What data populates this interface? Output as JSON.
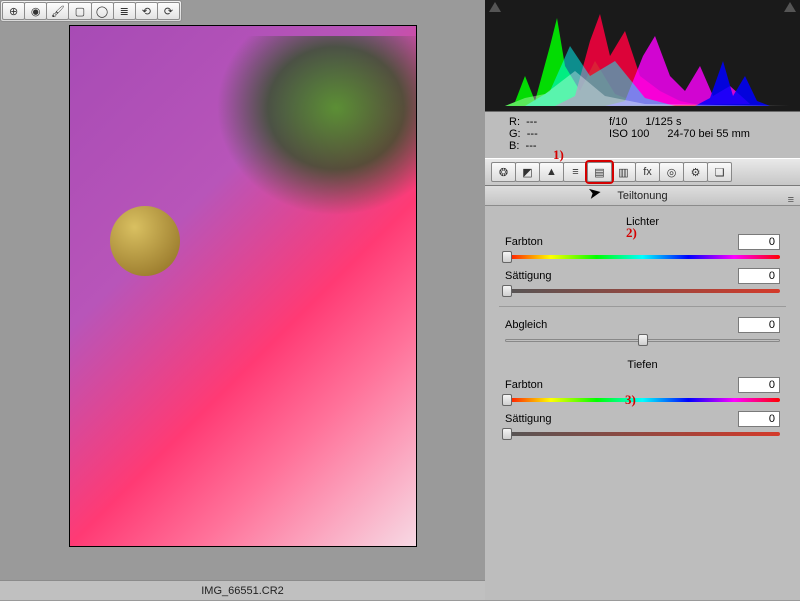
{
  "toolbar_left": {
    "items": [
      {
        "name": "target-tool-icon",
        "glyph": "⊕"
      },
      {
        "name": "eye-tool-icon",
        "glyph": "◉"
      },
      {
        "name": "brush-tool-icon",
        "glyph": "🖌"
      },
      {
        "name": "crop-tool-icon",
        "glyph": "▢"
      },
      {
        "name": "ellipse-tool-icon",
        "glyph": "◯"
      },
      {
        "name": "list-tool-icon",
        "glyph": "≣"
      },
      {
        "name": "rotate-ccw-icon",
        "glyph": "⟲"
      },
      {
        "name": "rotate-cw-icon",
        "glyph": "⟳"
      }
    ]
  },
  "filename": "IMG_66551.CR2",
  "readout": {
    "r_label": "R:",
    "r_val": "---",
    "g_label": "G:",
    "g_val": "---",
    "b_label": "B:",
    "b_val": "---",
    "aperture": "f/10",
    "shutter": "1/125 s",
    "iso": "ISO 100",
    "lens": "24-70 bei 55 mm"
  },
  "panel_toolbar": {
    "items": [
      {
        "name": "aperture-icon",
        "glyph": "❂"
      },
      {
        "name": "tonecurve-icon",
        "glyph": "◩"
      },
      {
        "name": "detail-icon",
        "glyph": "▲"
      },
      {
        "name": "hsl-icon",
        "glyph": "≡"
      },
      {
        "name": "splittone-icon",
        "glyph": "▤",
        "selected": true
      },
      {
        "name": "lens-icon",
        "glyph": "▥"
      },
      {
        "name": "fx-icon",
        "glyph": "fx"
      },
      {
        "name": "camera-icon",
        "glyph": "◎"
      },
      {
        "name": "sliders-icon",
        "glyph": "⚙"
      },
      {
        "name": "presets-icon",
        "glyph": "❏"
      }
    ]
  },
  "panel": {
    "title": "Teiltonung",
    "highlights": {
      "title": "Lichter",
      "hue_label": "Farbton",
      "hue_value": "0",
      "sat_label": "Sättigung",
      "sat_value": "0"
    },
    "balance": {
      "label": "Abgleich",
      "value": "0"
    },
    "shadows": {
      "title": "Tiefen",
      "hue_label": "Farbton",
      "hue_value": "0",
      "sat_label": "Sättigung",
      "sat_value": "0"
    }
  },
  "annotations": {
    "a1": "1)",
    "a2": "2)",
    "a3": "3)"
  }
}
